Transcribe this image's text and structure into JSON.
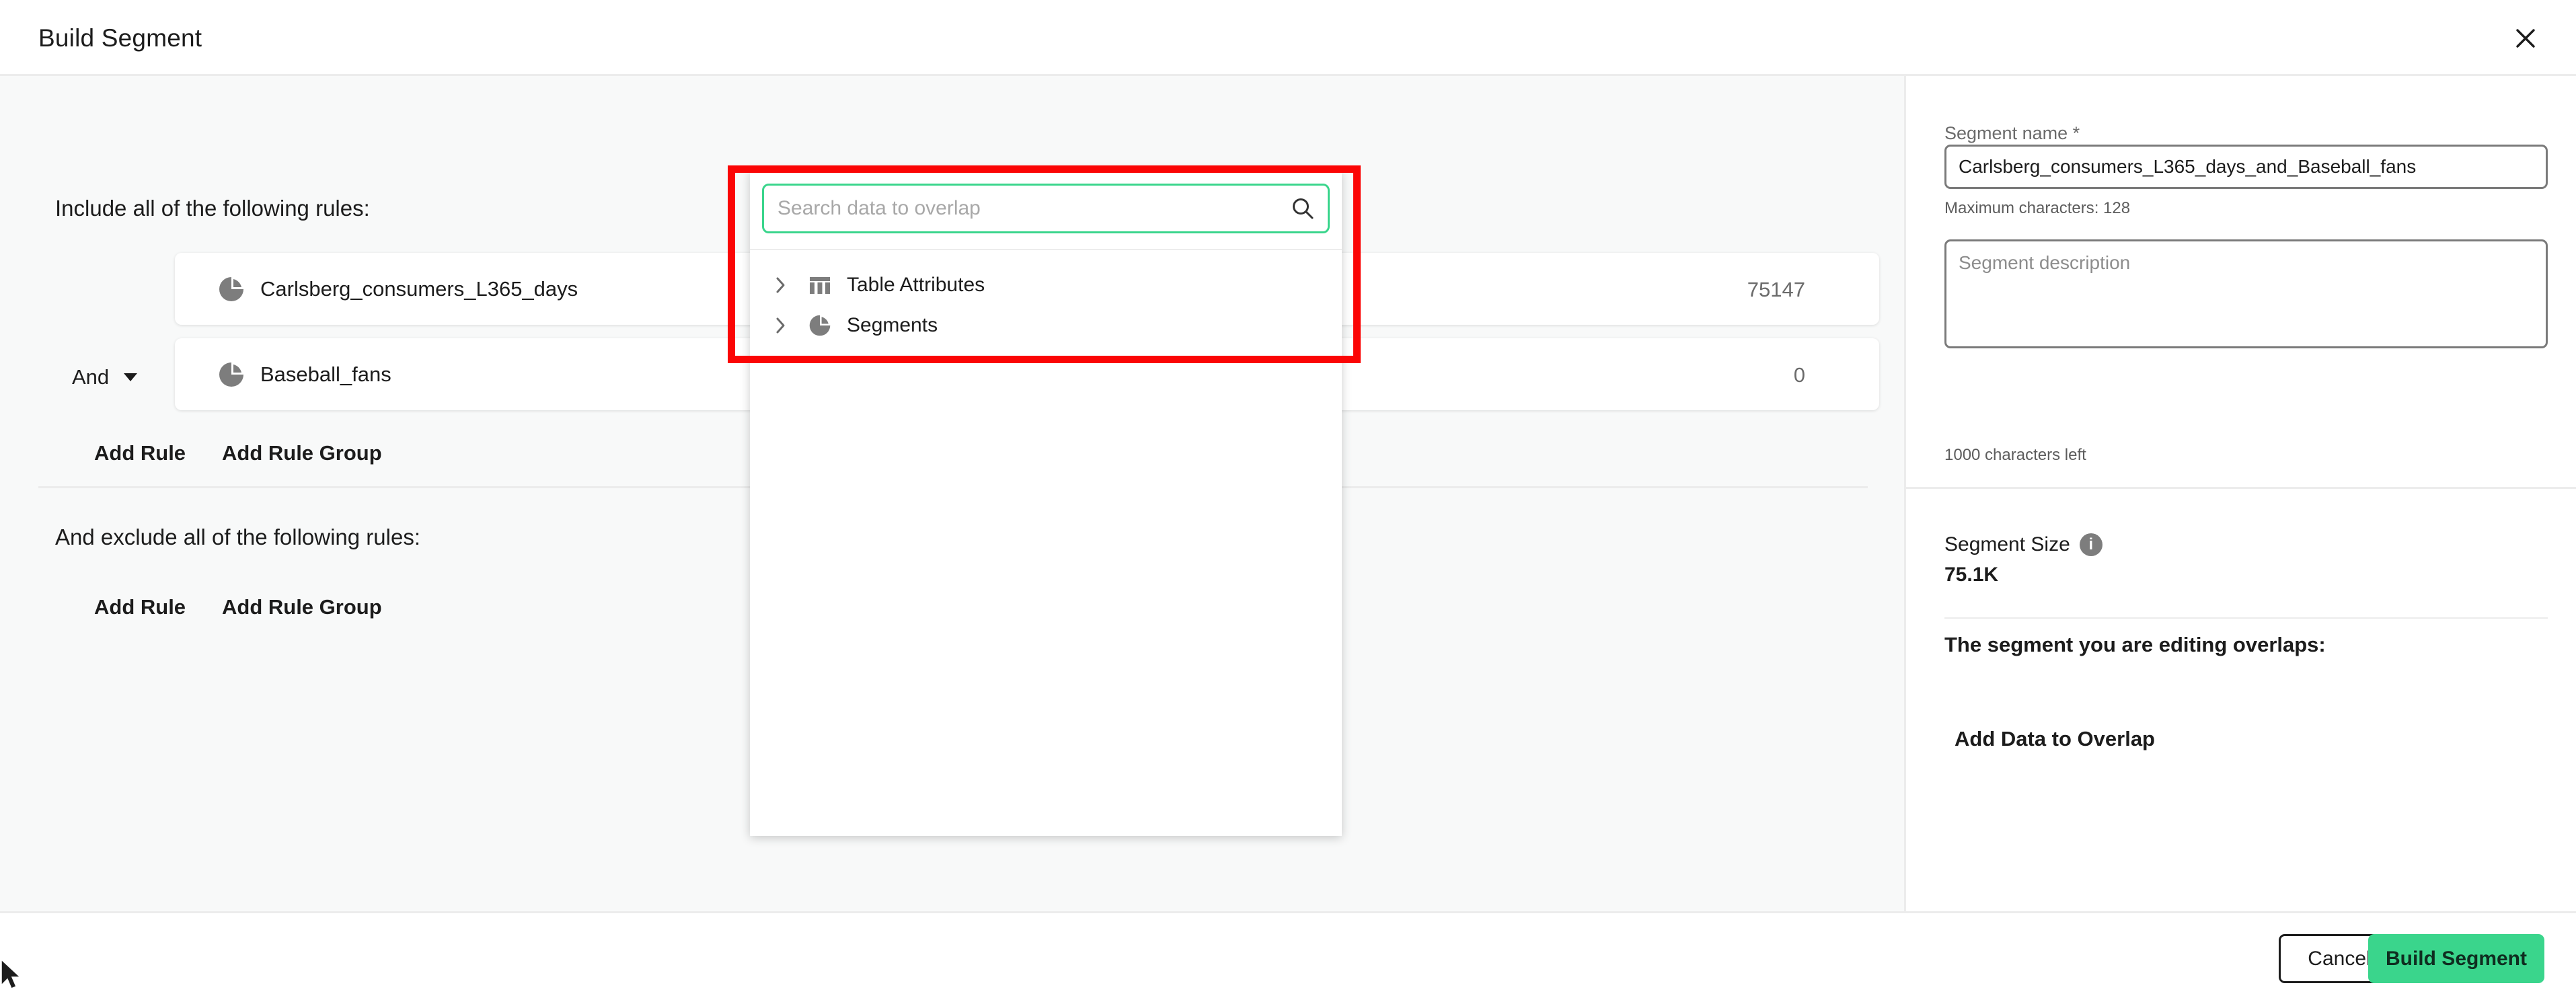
{
  "header": {
    "title": "Build Segment",
    "close_icon": "close-icon"
  },
  "rules": {
    "include_label": "Include all of the following rules:",
    "exclude_label": "And exclude all of the following rules:",
    "include_items": [
      {
        "icon": "pie-chart-icon",
        "name": "Carlsberg_consumers_L365_days",
        "count": "75147"
      },
      {
        "icon": "pie-chart-icon",
        "name": "Baseball_fans",
        "count": "0"
      }
    ],
    "operator": {
      "value": "And",
      "caret_icon": "chevron-down-icon"
    },
    "include_actions": {
      "add_rule": "Add Rule",
      "add_rule_group": "Add Rule Group"
    },
    "exclude_actions": {
      "add_rule": "Add Rule",
      "add_rule_group": "Add Rule Group"
    }
  },
  "overlap_dropdown": {
    "search": {
      "value": "",
      "placeholder": "Search data to overlap",
      "icon": "search-icon",
      "border_color": "#3ad58c"
    },
    "tree_items": [
      {
        "chevron_icon": "chevron-right-icon",
        "icon": "table-icon",
        "label": "Table Attributes"
      },
      {
        "chevron_icon": "chevron-right-icon",
        "icon": "pie-chart-icon",
        "label": "Segments"
      }
    ],
    "highlight_color": "#fb0505"
  },
  "right_panel": {
    "segment_name": {
      "label": "Segment name *",
      "value": "Carlsberg_consumers_L365_days_and_Baseball_fans",
      "placeholder": "Segment name",
      "hint": "Maximum characters: 128"
    },
    "segment_description": {
      "value": "",
      "placeholder": "Segment description",
      "hint": "1000 characters left"
    },
    "segment_size": {
      "title": "Segment Size",
      "info_icon": "info-icon",
      "info_glyph": "i",
      "value": "75.1K"
    },
    "overlap": {
      "heading": "The segment you are editing overlaps:",
      "add_data_label": "Add Data to Overlap"
    }
  },
  "footer": {
    "cancel_label": "Cancel",
    "build_label": "Build Segment",
    "build_color": "#3ad58c"
  }
}
